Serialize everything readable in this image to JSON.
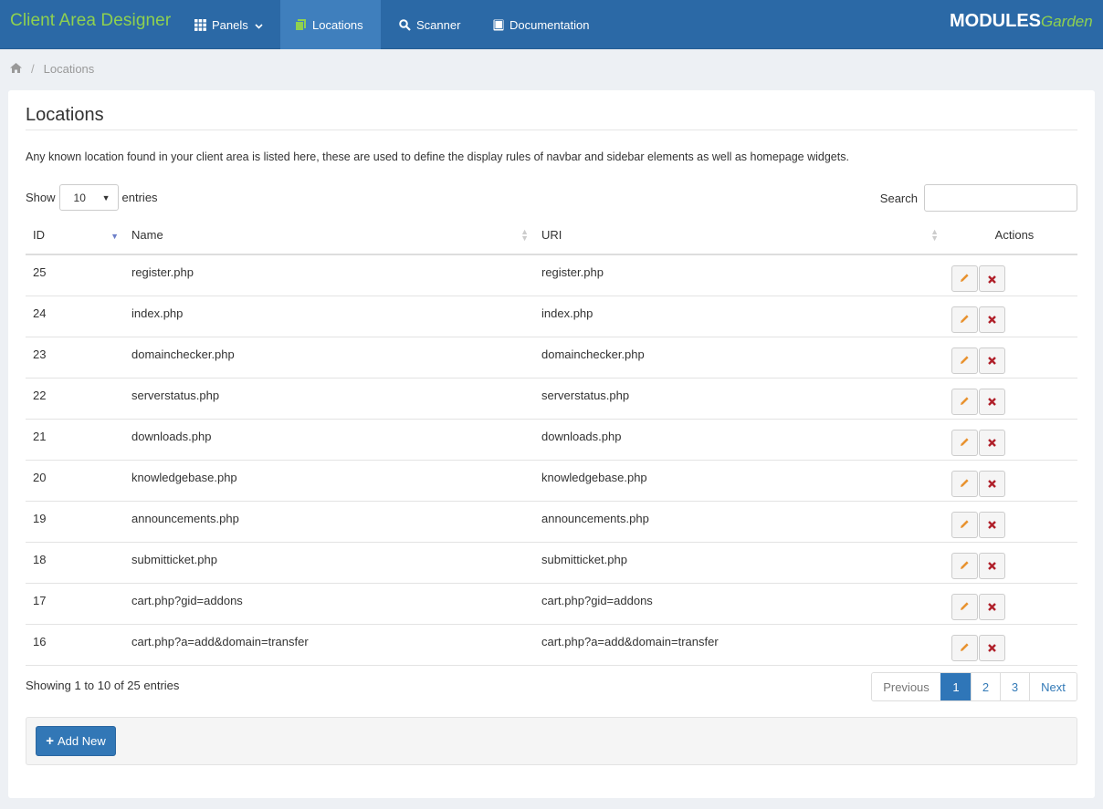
{
  "navbar": {
    "brand": "Client Area Designer",
    "items": [
      {
        "label": "Panels",
        "icon": "grid-icon",
        "active": false
      },
      {
        "label": "Locations",
        "icon": "files-icon",
        "active": true
      },
      {
        "label": "Scanner",
        "icon": "search-icon",
        "active": false
      },
      {
        "label": "Documentation",
        "icon": "book-icon",
        "active": false
      }
    ],
    "logo_main": "MODULES",
    "logo_sub": "Garden",
    "colors": {
      "bar": "#2b69a6",
      "active": "#3f7fbd",
      "brand": "#8fd14f"
    }
  },
  "breadcrumb": {
    "home_icon": "home-icon",
    "current": "Locations"
  },
  "page": {
    "title": "Locations",
    "description": "Any known location found in your client area is listed here, these are used to define the display rules of navbar and sidebar elements as well as homepage widgets."
  },
  "controls": {
    "show_label": "Show",
    "entries_value": "10",
    "entries_label": "entries",
    "search_label": "Search",
    "search_value": ""
  },
  "table": {
    "headers": {
      "id": "ID",
      "name": "Name",
      "uri": "URI",
      "actions": "Actions"
    },
    "sort": {
      "column": "ID",
      "direction": "descending"
    },
    "rows": [
      {
        "id": "25",
        "name": "register.php",
        "uri": "register.php"
      },
      {
        "id": "24",
        "name": "index.php",
        "uri": "index.php"
      },
      {
        "id": "23",
        "name": "domainchecker.php",
        "uri": "domainchecker.php"
      },
      {
        "id": "22",
        "name": "serverstatus.php",
        "uri": "serverstatus.php"
      },
      {
        "id": "21",
        "name": "downloads.php",
        "uri": "downloads.php"
      },
      {
        "id": "20",
        "name": "knowledgebase.php",
        "uri": "knowledgebase.php"
      },
      {
        "id": "19",
        "name": "announcements.php",
        "uri": "announcements.php"
      },
      {
        "id": "18",
        "name": "submitticket.php",
        "uri": "submitticket.php"
      },
      {
        "id": "17",
        "name": "cart.php?gid=addons",
        "uri": "cart.php?gid=addons"
      },
      {
        "id": "16",
        "name": "cart.php?a=add&domain=transfer",
        "uri": "cart.php?a=add&domain=transfer"
      }
    ],
    "row_actions": {
      "edit_icon": "pencil-icon",
      "delete_icon": "close-icon"
    }
  },
  "footer": {
    "info": "Showing 1 to 10 of 25 entries",
    "pagination": {
      "previous": "Previous",
      "pages": [
        "1",
        "2",
        "3"
      ],
      "current": "1",
      "next": "Next"
    },
    "add_button": "Add New"
  }
}
